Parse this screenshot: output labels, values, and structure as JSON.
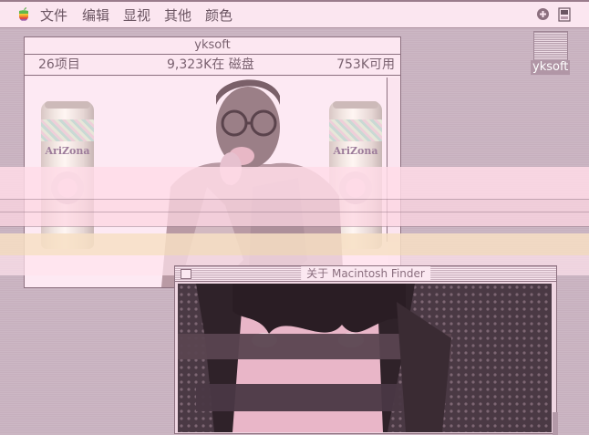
{
  "menubar": {
    "items": [
      "文件",
      "编辑",
      "显视",
      "其他",
      "颜色"
    ],
    "right_icons": [
      "help-icon",
      "application-menu-icon"
    ]
  },
  "finder_window": {
    "title": "yksoft",
    "item_count": "26项目",
    "disk_usage": "9,323K在 磁盘",
    "available": "753K可用"
  },
  "desktop": {
    "disk_label": "yksoft"
  },
  "about_window": {
    "title": "关于 Macintosh Finder"
  },
  "colors": {
    "menubar_bg": "#fbe6f0",
    "window_bg": "#fce7f1",
    "desktop_bg": "#c9b3c0",
    "border": "#8c707f"
  }
}
